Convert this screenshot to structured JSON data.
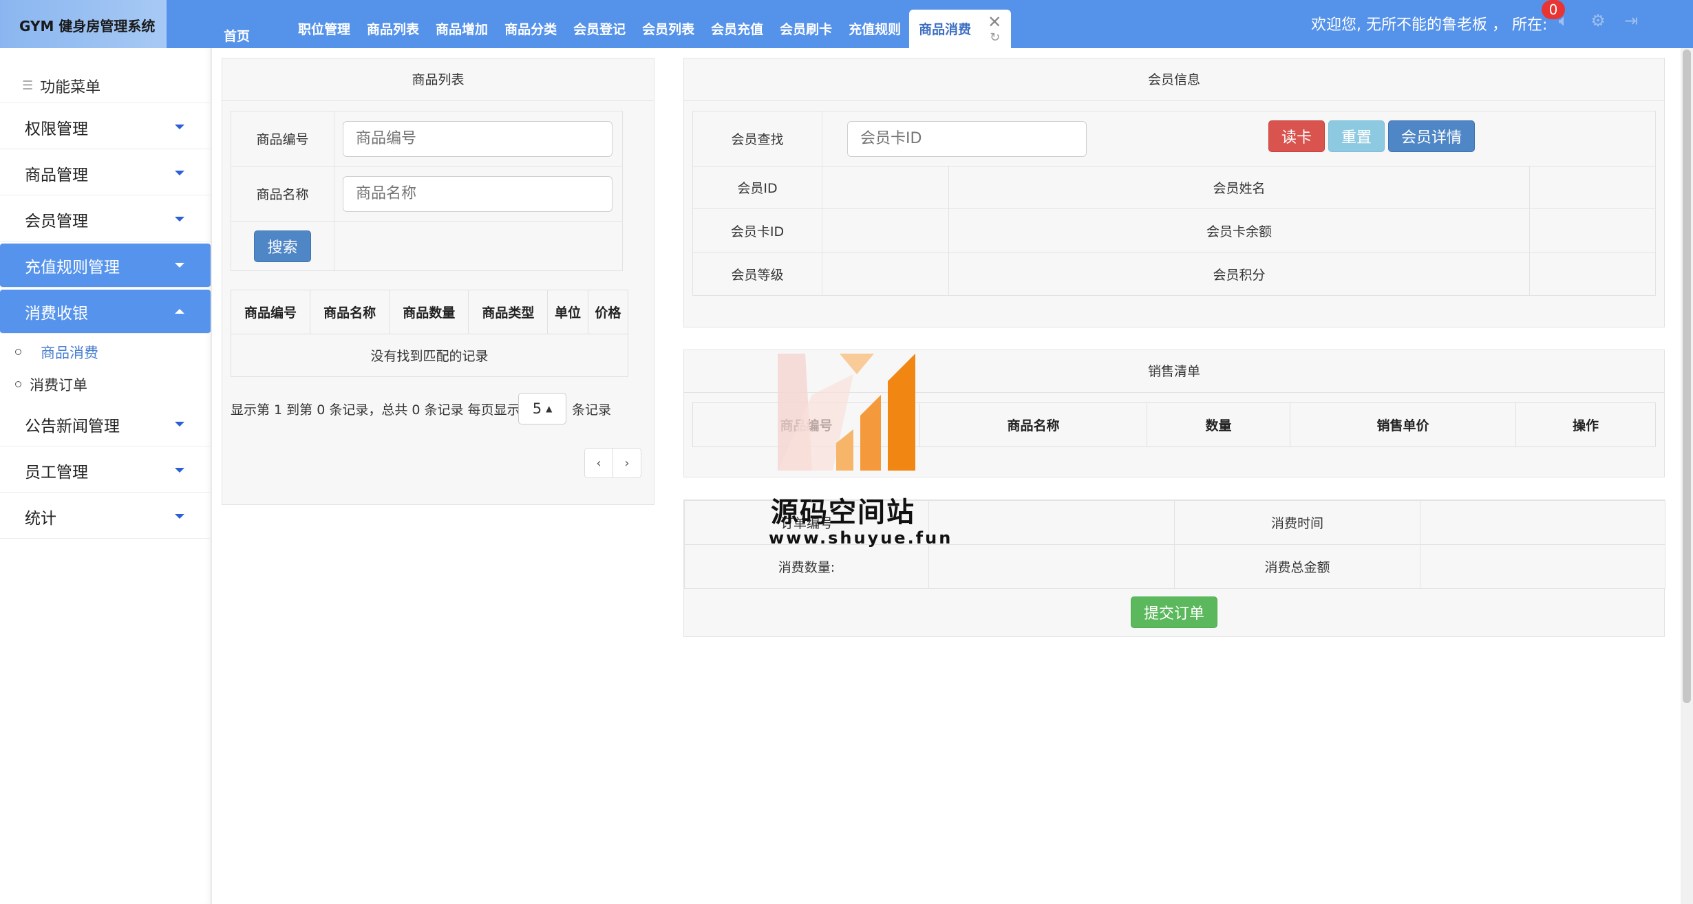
{
  "header": {
    "app_title": "GYM 健身房管理系统",
    "tabs": [
      "首页",
      "职位管理",
      "商品列表",
      "商品增加",
      "商品分类",
      "会员登记",
      "会员列表",
      "会员充值",
      "会员刷卡",
      "充值规则"
    ],
    "active_tab": "商品消费",
    "welcome": "欢迎您, 无所不能的鲁老板 ， 所在:",
    "notification_count": "0"
  },
  "sidebar": {
    "title": "功能菜单",
    "items": [
      {
        "label": "权限管理"
      },
      {
        "label": "商品管理"
      },
      {
        "label": "会员管理"
      },
      {
        "label": "充值规则管理"
      },
      {
        "label": "消费收银"
      }
    ],
    "sub_items": [
      {
        "label": "商品消费"
      },
      {
        "label": "消费订单"
      }
    ],
    "items_after": [
      {
        "label": "公告新闻管理"
      },
      {
        "label": "员工管理"
      },
      {
        "label": "统计"
      }
    ]
  },
  "product_panel": {
    "title": "商品列表",
    "code_label": "商品编号",
    "code_placeholder": "商品编号",
    "name_label": "商品名称",
    "name_placeholder": "商品名称",
    "search_button": "搜索",
    "columns": [
      "商品编号",
      "商品名称",
      "商品数量",
      "商品类型",
      "单位",
      "价格"
    ],
    "empty_text": "没有找到匹配的记录",
    "pager_text": "显示第 1 到第 0 条记录，总共 0 条记录",
    "per_page_prefix": "每页显示",
    "per_page_value": "5",
    "per_page_suffix": "条记录",
    "prev": "‹",
    "next": "›"
  },
  "member_panel": {
    "title": "会员信息",
    "search_label": "会员查找",
    "card_placeholder": "会员卡ID",
    "read_card": "读卡",
    "reset": "重置",
    "detail": "会员详情",
    "member_id": "会员ID",
    "member_name": "会员姓名",
    "card_id": "会员卡ID",
    "card_balance": "会员卡余额",
    "level": "会员等级",
    "points": "会员积分"
  },
  "sales_panel": {
    "title": "销售清单",
    "columns": [
      "商品编号",
      "商品名称",
      "数量",
      "销售单价",
      "操作"
    ]
  },
  "order_panel": {
    "order_no": "订单编号",
    "consume_time": "消费时间",
    "consume_qty": "消费数量:",
    "consume_total": "消费总金额",
    "submit": "提交订单"
  },
  "watermark": {
    "text": "源码空间站",
    "url": "www.shuyue.fun"
  }
}
